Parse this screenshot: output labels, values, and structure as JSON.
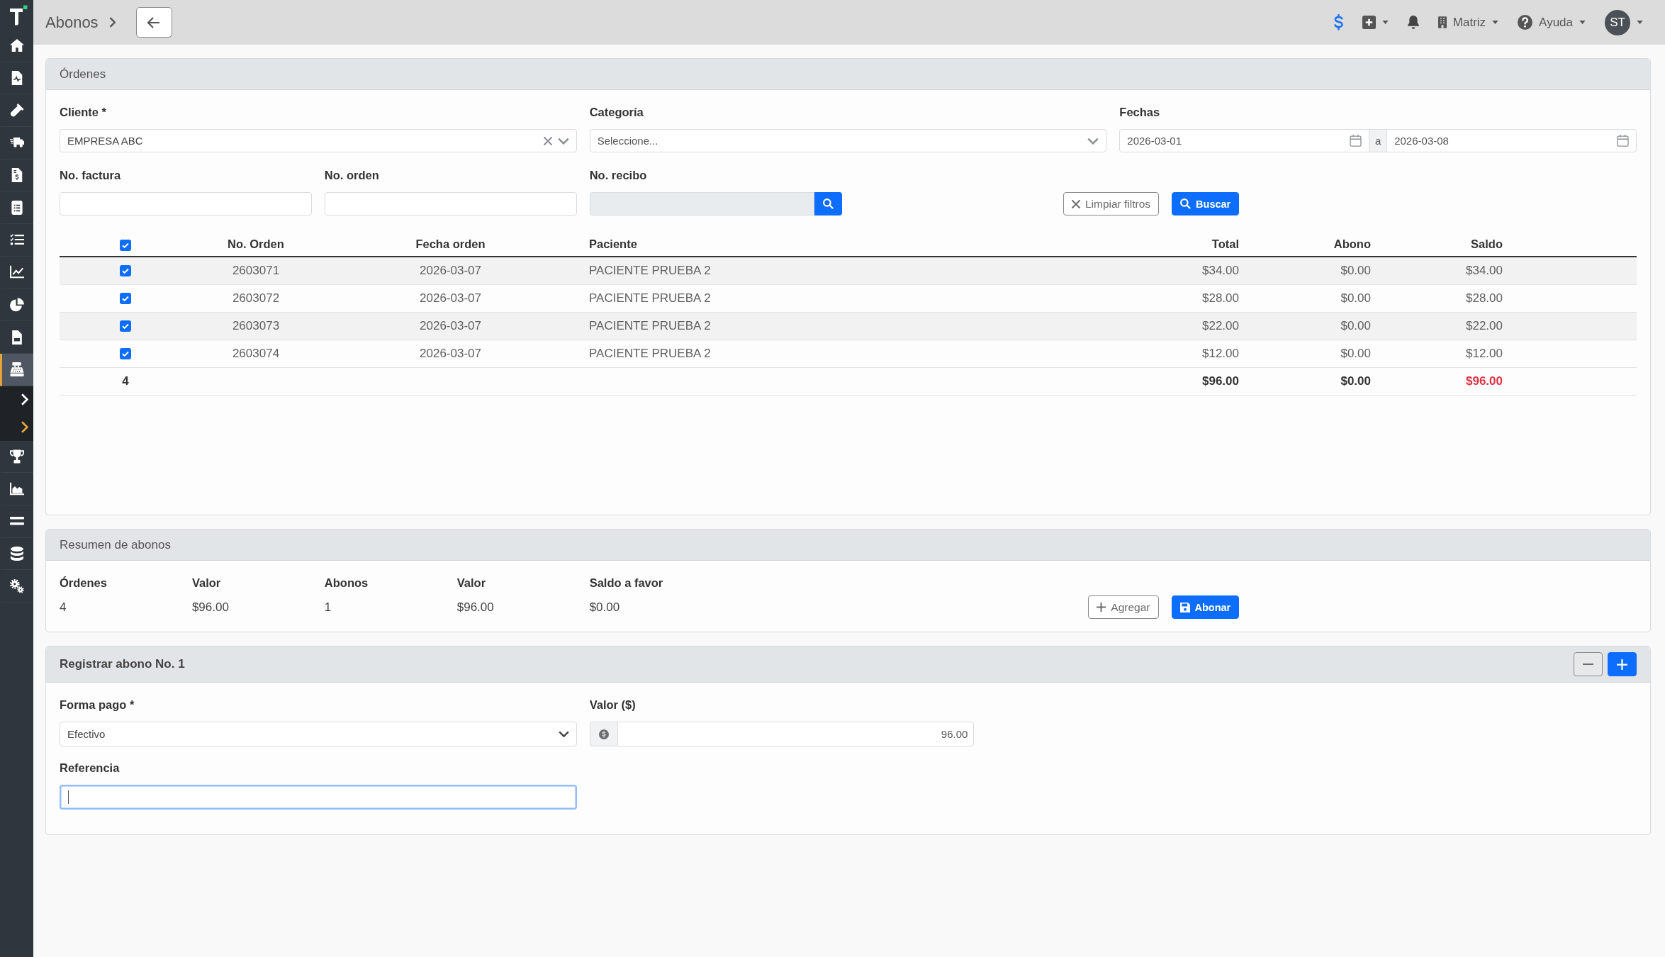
{
  "sidebar": {
    "items": [
      {
        "kind": "link",
        "selected": false
      },
      {
        "kind": "link",
        "selected": false
      },
      {
        "kind": "link",
        "selected": false
      },
      {
        "kind": "link",
        "selected": false
      },
      {
        "kind": "link",
        "selected": false
      },
      {
        "kind": "link",
        "selected": false
      },
      {
        "kind": "link",
        "selected": false
      },
      {
        "kind": "link",
        "selected": false
      },
      {
        "kind": "link",
        "selected": false
      },
      {
        "kind": "link",
        "selected": false
      },
      {
        "kind": "link",
        "selected": true
      },
      {
        "kind": "toggle",
        "active": false
      },
      {
        "kind": "toggle",
        "active": true
      },
      {
        "kind": "link",
        "selected": false
      },
      {
        "kind": "link",
        "selected": false
      },
      {
        "kind": "link",
        "selected": false
      },
      {
        "kind": "link",
        "selected": false
      },
      {
        "kind": "link",
        "selected": false
      }
    ]
  },
  "topbar": {
    "title": "Abonos",
    "branch": "Matriz",
    "help": "Ayuda",
    "user_initials": "ST"
  },
  "orders_card": {
    "title": "Órdenes",
    "filters": {
      "client": {
        "label": "Cliente *",
        "value": "EMPRESA ABC"
      },
      "category": {
        "label": "Categoría",
        "placeholder": "Seleccione..."
      },
      "dates": {
        "label": "Fechas",
        "from": "2026-03-01",
        "separator": "a",
        "to": "2026-03-08"
      },
      "invoice": {
        "label": "No. factura",
        "disabled": false
      },
      "order": {
        "label": "No. orden",
        "disabled": false
      },
      "receipt": {
        "label": "No. recibo",
        "disabled": true
      }
    },
    "buttons": [
      {
        "label": "Limpiar filtros",
        "kind": "outline"
      },
      {
        "label": "Buscar",
        "kind": "primary"
      }
    ],
    "table": {
      "all_checked": true,
      "columns": [
        "No. Orden",
        "Fecha orden",
        "Paciente",
        "Total",
        "Abono",
        "Saldo"
      ],
      "rows": [
        {
          "checked": true,
          "cells": [
            "2603071",
            "2026-03-07",
            "PACIENTE PRUEBA 2",
            "$34.00",
            "$0.00",
            "$34.00"
          ]
        },
        {
          "checked": true,
          "cells": [
            "2603072",
            "2026-03-07",
            "PACIENTE PRUEBA 2",
            "$28.00",
            "$0.00",
            "$28.00"
          ]
        },
        {
          "checked": true,
          "cells": [
            "2603073",
            "2026-03-07",
            "PACIENTE PRUEBA 2",
            "$22.00",
            "$0.00",
            "$22.00"
          ]
        },
        {
          "checked": true,
          "cells": [
            "2603074",
            "2026-03-07",
            "PACIENTE PRUEBA 2",
            "$12.00",
            "$0.00",
            "$12.00"
          ]
        }
      ],
      "totals": {
        "count": "4",
        "total": "$96.00",
        "paid": "$0.00",
        "balance": "$96.00",
        "balance_due": true
      }
    }
  },
  "summary_card": {
    "title": "Resumen de abonos",
    "columns": [
      {
        "label": "Órdenes",
        "value": "4"
      },
      {
        "label": "Valor",
        "value": "$96.00"
      },
      {
        "label": "Abonos",
        "value": "1"
      },
      {
        "label": "Valor",
        "value": "$96.00"
      },
      {
        "label": "Saldo a favor",
        "value": "$0.00"
      }
    ],
    "buttons": [
      {
        "label": "Agregar",
        "kind": "outline"
      },
      {
        "label": "Abonar",
        "kind": "primary"
      }
    ]
  },
  "payment_card": {
    "title": "Registrar abono No. 1",
    "rows": [
      [
        {
          "kind": "select",
          "label": "Forma pago *",
          "value": "Efectivo"
        },
        {
          "kind": "money",
          "label": "Valor ($)",
          "value": "96.00"
        }
      ],
      [
        {
          "kind": "text",
          "label": "Referencia",
          "focused": true
        }
      ]
    ]
  }
}
